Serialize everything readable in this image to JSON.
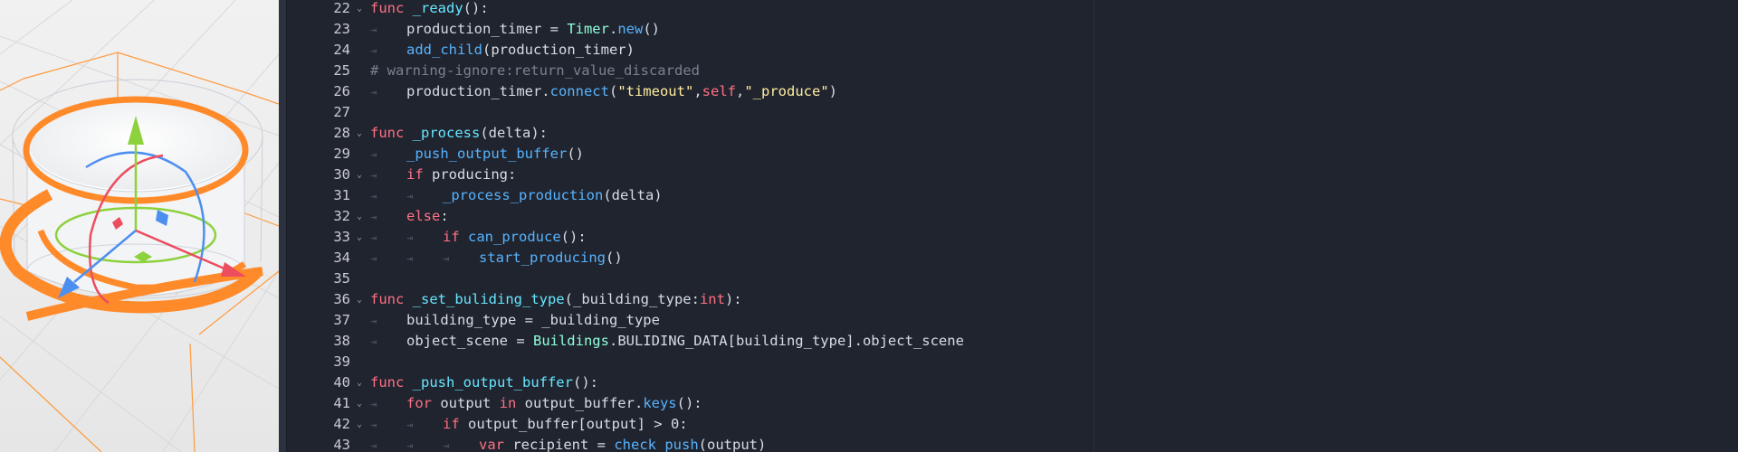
{
  "editor": {
    "lines": [
      {
        "num": "22",
        "fold": true,
        "tokens": [
          {
            "t": "func",
            "c": "kw"
          },
          {
            "t": " ",
            "c": "plain"
          },
          {
            "t": "_ready",
            "c": "def"
          },
          {
            "t": "():",
            "c": "plain"
          }
        ]
      },
      {
        "num": "23",
        "indent": 1,
        "tokens": [
          {
            "t": "production_timer = ",
            "c": "plain"
          },
          {
            "t": "Timer",
            "c": "cls"
          },
          {
            "t": ".",
            "c": "plain"
          },
          {
            "t": "new",
            "c": "fn"
          },
          {
            "t": "()",
            "c": "plain"
          }
        ]
      },
      {
        "num": "24",
        "indent": 1,
        "tokens": [
          {
            "t": "add_child",
            "c": "fn"
          },
          {
            "t": "(production_timer)",
            "c": "plain"
          }
        ]
      },
      {
        "num": "25",
        "tokens": [
          {
            "t": "# warning-ignore:return_value_discarded",
            "c": "cmt"
          }
        ]
      },
      {
        "num": "26",
        "indent": 1,
        "tokens": [
          {
            "t": "production_timer.",
            "c": "plain"
          },
          {
            "t": "connect",
            "c": "fn"
          },
          {
            "t": "(",
            "c": "plain"
          },
          {
            "t": "\"timeout\"",
            "c": "str"
          },
          {
            "t": ",",
            "c": "plain"
          },
          {
            "t": "self",
            "c": "kw"
          },
          {
            "t": ",",
            "c": "plain"
          },
          {
            "t": "\"_produce\"",
            "c": "str"
          },
          {
            "t": ")",
            "c": "plain"
          }
        ]
      },
      {
        "num": "27",
        "tokens": []
      },
      {
        "num": "28",
        "fold": true,
        "tokens": [
          {
            "t": "func",
            "c": "kw"
          },
          {
            "t": " ",
            "c": "plain"
          },
          {
            "t": "_process",
            "c": "def"
          },
          {
            "t": "(delta):",
            "c": "plain"
          }
        ]
      },
      {
        "num": "29",
        "indent": 1,
        "tokens": [
          {
            "t": "_push_output_buffer",
            "c": "fn"
          },
          {
            "t": "()",
            "c": "plain"
          }
        ]
      },
      {
        "num": "30",
        "fold": true,
        "indent": 1,
        "tokens": [
          {
            "t": "if",
            "c": "kw"
          },
          {
            "t": " producing:",
            "c": "plain"
          }
        ]
      },
      {
        "num": "31",
        "indent": 2,
        "tokens": [
          {
            "t": "_process_production",
            "c": "fn"
          },
          {
            "t": "(delta)",
            "c": "plain"
          }
        ]
      },
      {
        "num": "32",
        "fold": true,
        "indent": 1,
        "tokens": [
          {
            "t": "else",
            "c": "kw"
          },
          {
            "t": ":",
            "c": "plain"
          }
        ]
      },
      {
        "num": "33",
        "fold": true,
        "indent": 2,
        "tokens": [
          {
            "t": "if",
            "c": "kw"
          },
          {
            "t": " ",
            "c": "plain"
          },
          {
            "t": "can_produce",
            "c": "fn"
          },
          {
            "t": "():",
            "c": "plain"
          }
        ]
      },
      {
        "num": "34",
        "indent": 3,
        "tokens": [
          {
            "t": "start_producing",
            "c": "fn"
          },
          {
            "t": "()",
            "c": "plain"
          }
        ]
      },
      {
        "num": "35",
        "tokens": []
      },
      {
        "num": "36",
        "fold": true,
        "tokens": [
          {
            "t": "func",
            "c": "kw"
          },
          {
            "t": " ",
            "c": "plain"
          },
          {
            "t": "_set_buliding_type",
            "c": "def"
          },
          {
            "t": "(_building_type:",
            "c": "plain"
          },
          {
            "t": "int",
            "c": "kw"
          },
          {
            "t": "):",
            "c": "plain"
          }
        ]
      },
      {
        "num": "37",
        "indent": 1,
        "tokens": [
          {
            "t": "building_type = _building_type",
            "c": "plain"
          }
        ]
      },
      {
        "num": "38",
        "indent": 1,
        "tokens": [
          {
            "t": "object_scene = ",
            "c": "plain"
          },
          {
            "t": "Buildings",
            "c": "cls"
          },
          {
            "t": ".BULIDING_DATA[building_type].object_scene",
            "c": "plain"
          }
        ]
      },
      {
        "num": "39",
        "tokens": []
      },
      {
        "num": "40",
        "fold": true,
        "tokens": [
          {
            "t": "func",
            "c": "kw"
          },
          {
            "t": " ",
            "c": "plain"
          },
          {
            "t": "_push_output_buffer",
            "c": "def"
          },
          {
            "t": "():",
            "c": "plain"
          }
        ]
      },
      {
        "num": "41",
        "fold": true,
        "indent": 1,
        "tokens": [
          {
            "t": "for",
            "c": "kw"
          },
          {
            "t": " output ",
            "c": "plain"
          },
          {
            "t": "in",
            "c": "kw"
          },
          {
            "t": " output_buffer.",
            "c": "plain"
          },
          {
            "t": "keys",
            "c": "fn"
          },
          {
            "t": "():",
            "c": "plain"
          }
        ]
      },
      {
        "num": "42",
        "fold": true,
        "indent": 2,
        "tokens": [
          {
            "t": "if",
            "c": "kw"
          },
          {
            "t": " output_buffer[output] > 0:",
            "c": "plain"
          }
        ]
      },
      {
        "num": "43",
        "indent": 3,
        "tokens": [
          {
            "t": "var",
            "c": "kw"
          },
          {
            "t": " recipient = ",
            "c": "plain"
          },
          {
            "t": "check_push",
            "c": "fn"
          },
          {
            "t": "(output)",
            "c": "plain"
          }
        ]
      }
    ]
  },
  "glyphs": {
    "fold": "⌄",
    "tab": "⇥"
  },
  "colors": {
    "gizmo_y": "#8dd13d",
    "gizmo_x": "#ec4d5f",
    "gizmo_z": "#4d8ff0",
    "selection": "#ff8a2a"
  }
}
